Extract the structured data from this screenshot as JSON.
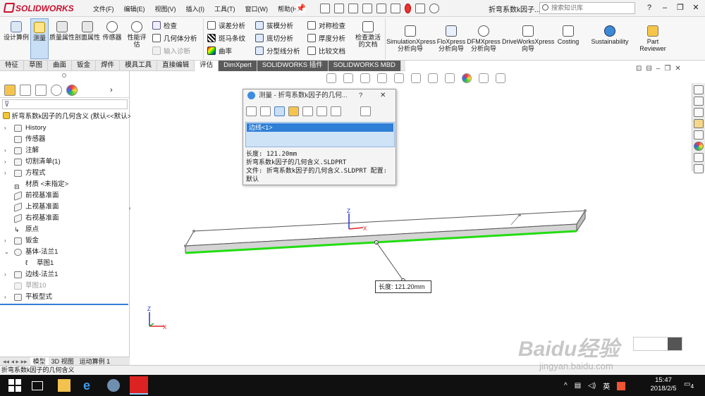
{
  "app": {
    "name": "SOLIDWORKS",
    "doc_title": "折弯系数k因子..."
  },
  "menus": [
    "文件(F)",
    "编辑(E)",
    "视图(V)",
    "插入(I)",
    "工具(T)",
    "窗口(W)",
    "帮助(H)"
  ],
  "search": {
    "placeholder": "搜索知识库"
  },
  "ribbon": {
    "big": [
      {
        "label": "设计算例",
        "icon": "design-study-icon"
      },
      {
        "label": "测量",
        "icon": "measure-icon"
      },
      {
        "label": "质量属性",
        "icon": "mass-properties-icon"
      },
      {
        "label": "剖面属性",
        "icon": "section-properties-icon"
      },
      {
        "label": "传感器",
        "icon": "sensor-icon"
      },
      {
        "label": "性能评估",
        "icon": "performance-eval-icon"
      }
    ],
    "small1": [
      {
        "label": "检查"
      },
      {
        "label": "几何体分析"
      },
      {
        "label": "输入诊断"
      }
    ],
    "small2": [
      {
        "label": "误差分析"
      },
      {
        "label": "斑马条纹"
      },
      {
        "label": "曲率"
      }
    ],
    "small3": [
      {
        "label": "拔模分析"
      },
      {
        "label": "底切分析"
      },
      {
        "label": "分型线分析"
      }
    ],
    "small4": [
      {
        "label": "对称检查"
      },
      {
        "label": "厚度分析"
      },
      {
        "label": "比较文档"
      }
    ],
    "activate": "检查激活的文档",
    "addins": [
      {
        "label": "SimulationXpress 分析向导"
      },
      {
        "label": "FloXpress 分析向导"
      },
      {
        "label": "DFMXpress 分析向导"
      },
      {
        "label": "DriveWorksXpress 向导"
      },
      {
        "label": "Costing"
      },
      {
        "label": "Sustainability"
      },
      {
        "label": "Part Reviewer"
      }
    ]
  },
  "tabs": [
    "特征",
    "草图",
    "曲面",
    "钣金",
    "焊件",
    "模具工具",
    "直接编辑",
    "评估",
    "DimXpert",
    "SOLIDWORKS 插件",
    "SOLIDWORKS MBD"
  ],
  "tree": {
    "root": "折弯系数k因子的几何含义 (默认<<默认>",
    "items": [
      {
        "label": "History",
        "icon": "history-icon"
      },
      {
        "label": "传感器",
        "icon": "sensor-icon"
      },
      {
        "label": "注解",
        "icon": "annotation-icon"
      },
      {
        "label": "切割清单(1)",
        "icon": "cutlist-icon"
      },
      {
        "label": "方程式",
        "icon": "equation-icon"
      },
      {
        "label": "材质 <未指定>",
        "icon": "material-icon"
      },
      {
        "label": "前视基准面",
        "icon": "plane-icon"
      },
      {
        "label": "上视基准面",
        "icon": "plane-icon"
      },
      {
        "label": "右视基准面",
        "icon": "plane-icon"
      },
      {
        "label": "原点",
        "icon": "origin-icon"
      },
      {
        "label": "钣金",
        "icon": "sheetmetal-icon"
      },
      {
        "label": "基体-法兰1",
        "icon": "base-flange-icon"
      },
      {
        "label": "草图1",
        "icon": "sketch-icon"
      },
      {
        "label": "边线-法兰1",
        "icon": "edge-flange-icon"
      },
      {
        "label": "草图10",
        "icon": "sketch-icon"
      },
      {
        "label": "平板型式",
        "icon": "flat-pattern-icon"
      }
    ]
  },
  "bottom_tabs": [
    "模型",
    "3D 视图",
    "运动算例 1"
  ],
  "status": "折弯系数k因子的几何含义",
  "measure": {
    "title": "测量 - 折弯系数k因子的几何...",
    "help": "?",
    "close": "✕",
    "selection": "边线<1>",
    "lines": [
      "长度: 121.20mm",
      "折弯系数k因子的几何含义.SLDPRT",
      "文件: 折弯系数k因子的几何含义.SLDPRT 配置: 默认"
    ]
  },
  "callout": "长度: 121.20mm",
  "watermark": {
    "logo": "Baidu经验",
    "url": "jingyan.baidu.com"
  },
  "taskbar": {
    "time": "15:47",
    "date": "2018/2/5",
    "ime": "英",
    "notif": "4"
  },
  "colors": {
    "accent": "#2f7fd6",
    "edge_green": "#22dd11",
    "brand": "#c8102e"
  }
}
